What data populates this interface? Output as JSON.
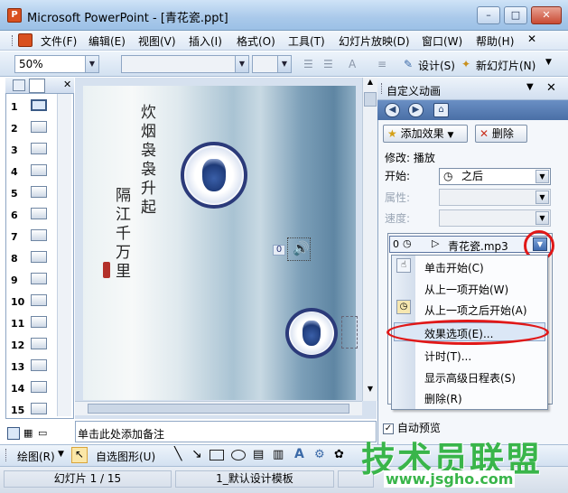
{
  "window": {
    "title": "Microsoft PowerPoint - [青花瓷.ppt]",
    "app_icon": "P"
  },
  "menu": [
    "文件(F)",
    "编辑(E)",
    "视图(V)",
    "插入(I)",
    "格式(O)",
    "工具(T)",
    "幻灯片放映(D)",
    "窗口(W)",
    "帮助(H)"
  ],
  "toolbar": {
    "zoom": "50%",
    "design_label": "设计(S)",
    "new_slide_label": "新幻灯片(N)"
  },
  "slides": {
    "numbers": [
      "1",
      "2",
      "3",
      "4",
      "5",
      "6",
      "7",
      "8",
      "9",
      "10",
      "11",
      "12",
      "13",
      "14",
      "15"
    ],
    "selected": "1"
  },
  "slide": {
    "calligraphy_1": "炊烟袅袅升起",
    "calligraphy_2": "隔江千万里",
    "sound_index": "0"
  },
  "notes": {
    "placeholder": "单击此处添加备注"
  },
  "taskpane": {
    "title": "自定义动画",
    "add_effect": "添加效果",
    "remove": "删除",
    "modify": "修改: 播放",
    "start_label": "开始:",
    "start_value": "之后",
    "property_label": "属性:",
    "speed_label": "速度:",
    "list_item": {
      "index": "0",
      "name": "青花瓷.mp3"
    },
    "context_menu": [
      "单击开始(C)",
      "从上一项开始(W)",
      "从上一项之后开始(A)",
      "效果选项(E)...",
      "计时(T)...",
      "显示高级日程表(S)",
      "删除(R)"
    ],
    "highlighted": "效果选项(E)...",
    "autopreview": "自动预览"
  },
  "drawbar": {
    "draw": "绘图(R)",
    "autoshapes": "自选图形(U)"
  },
  "status": {
    "slide": "幻灯片 1 / 15",
    "template": "1_默认设计模板"
  },
  "watermark": {
    "text": "技术员联盟",
    "url": "www.jsgho.com"
  },
  "colors": {
    "accent": "#2b3a7a",
    "highlight_ring": "#e01818",
    "watermark": "#39b54a"
  }
}
